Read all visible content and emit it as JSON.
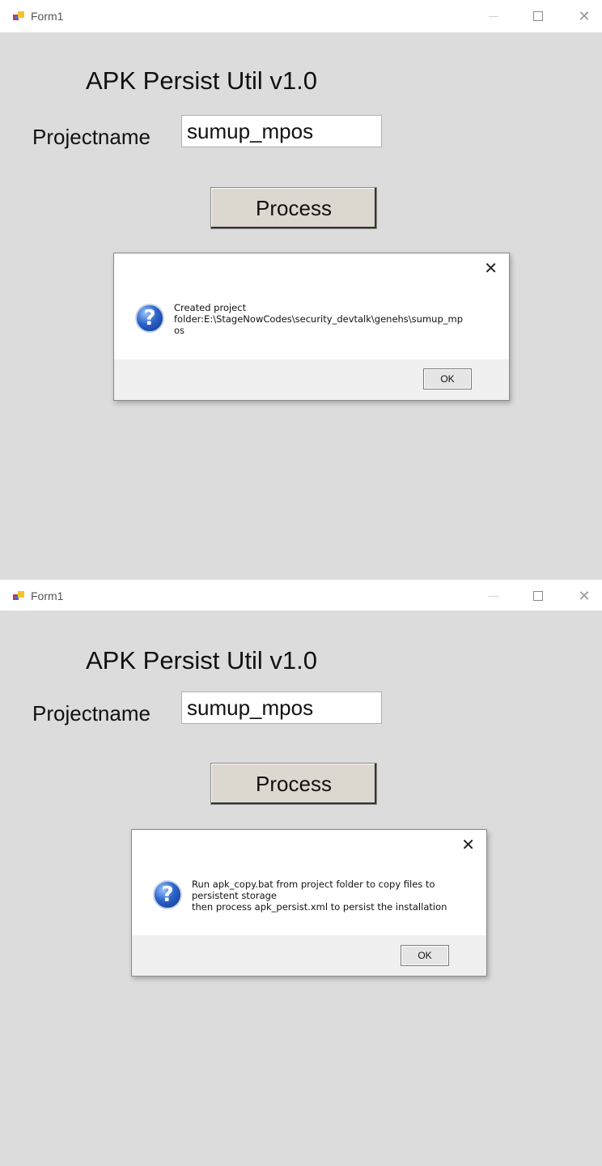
{
  "window1": {
    "title": "Form1",
    "heading": "APK Persist Util v1.0",
    "project_label": "Projectname",
    "project_value": "sumup_mpos",
    "process_label": "Process",
    "dialog": {
      "close_glyph": "✕",
      "message_lines": [
        "Created project",
        "folder:E:\\StageNowCodes\\security_devtalk\\genehs\\sumup_mp",
        "os"
      ],
      "ok_label": "OK"
    }
  },
  "window2": {
    "title": "Form1",
    "heading": "APK Persist Util v1.0",
    "project_label": "Projectname",
    "project_value": "sumup_mpos",
    "process_label": "Process",
    "dialog": {
      "close_glyph": "✕",
      "message_lines": [
        "Run apk_copy.bat from project folder to copy files to",
        "persistent storage",
        "then process apk_persist.xml to persist the installation"
      ],
      "ok_label": "OK"
    }
  },
  "icons": {
    "app": "winforms-app-icon",
    "question": "question-icon",
    "question_glyph": "?"
  },
  "colors": {
    "form_bg": "#dcdcdc",
    "titlebar_bg": "#ffffff",
    "button_bg": "#ddd8cf"
  }
}
